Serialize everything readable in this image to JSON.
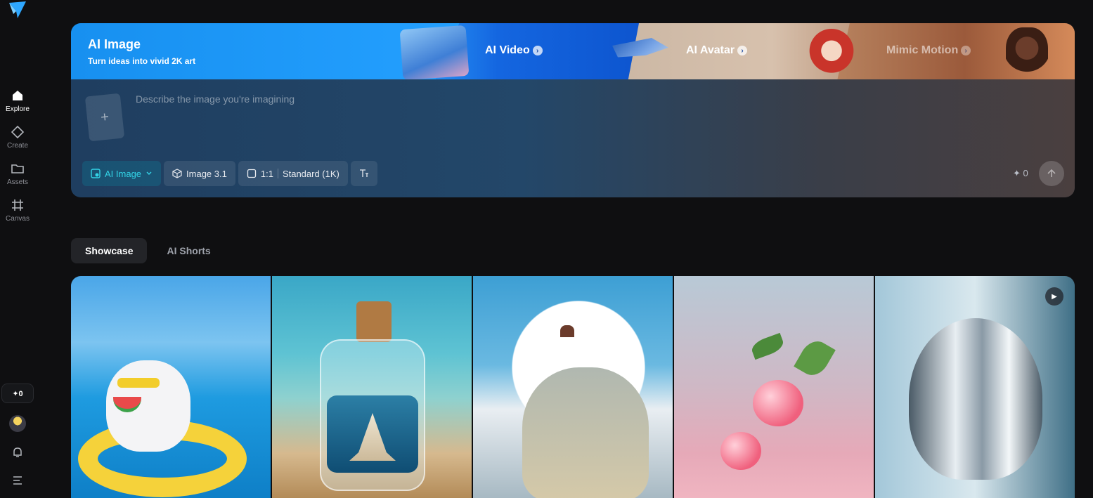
{
  "sidebar": {
    "logo": "app-logo",
    "nav": [
      {
        "label": "Explore",
        "icon": "home-icon",
        "active": true
      },
      {
        "label": "Create",
        "icon": "diamond-icon"
      },
      {
        "label": "Assets",
        "icon": "folder-icon"
      },
      {
        "label": "Canvas",
        "icon": "crop-icon"
      }
    ],
    "credits": "✦0"
  },
  "hero": {
    "main_tab": {
      "title": "AI Image",
      "subtitle": "Turn ideas into vivid 2K art"
    },
    "tabs": [
      {
        "label": "AI Video"
      },
      {
        "label": "AI Avatar"
      },
      {
        "label": "Mimic Motion"
      }
    ],
    "prompt": {
      "placeholder": "Describe the image you're imagining",
      "value": "",
      "upload_icon": "+"
    },
    "toolbar": {
      "mode": "AI Image",
      "model": "Image 3.1",
      "ratio": "1:1",
      "quality": "Standard (1K)"
    },
    "cost": "✦ 0"
  },
  "section_tabs": [
    {
      "label": "Showcase",
      "active": true
    },
    {
      "label": "AI Shorts"
    }
  ],
  "gallery": [
    {
      "subject": "white cat with sunglasses eating watermelon on pool float"
    },
    {
      "subject": "ship in a bottle on beach"
    },
    {
      "subject": "anime girl sitting on giant cat in clouds"
    },
    {
      "subject": "pink cherries splashing in water"
    },
    {
      "subject": "chrome metallic tulip",
      "video": true
    }
  ],
  "colors": {
    "accent": "#33d3e6",
    "hero_blue": "#1790f0",
    "bg": "#0f0f11"
  }
}
